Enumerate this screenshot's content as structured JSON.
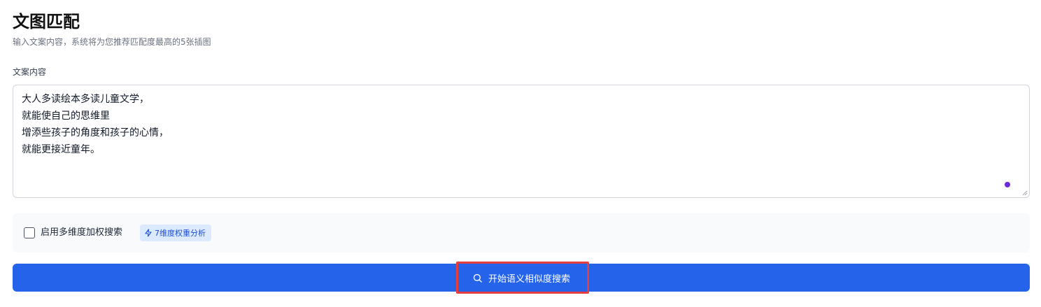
{
  "header": {
    "title": "文图匹配",
    "subtitle": "输入文案内容，系统将为您推荐匹配度最高的5张插图"
  },
  "content_field": {
    "label": "文案内容",
    "value": "大人多读绘本多读儿童文学，\n就能使自己的思维里\n增添些孩子的角度和孩子的心情，\n就能更接近童年。"
  },
  "options": {
    "weighted_search_label": "启用多维度加权搜索",
    "weighted_search_checked": false,
    "badge_label": "7维度权重分析",
    "badge_icon": "lightning-icon"
  },
  "actions": {
    "search_label": "开始语义相似度搜索",
    "search_icon": "search-icon"
  },
  "colors": {
    "accent": "#2563eb",
    "badge_bg": "#dbeafe",
    "badge_text": "#1d4ed8",
    "highlight": "#e53e3e",
    "assist_dot": "#6d28d9"
  }
}
